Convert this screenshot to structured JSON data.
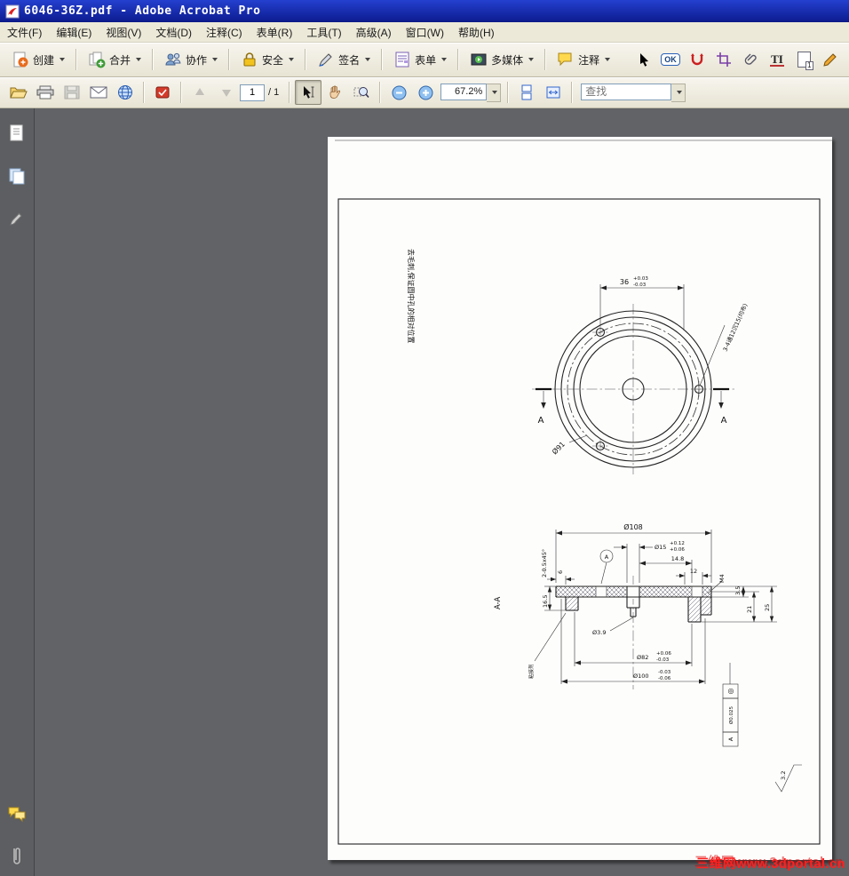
{
  "window": {
    "title": "6046-36Z.pdf - Adobe Acrobat Pro"
  },
  "colors": {
    "titlebar": "#1b2fb8",
    "toolbar": "#ece9d8",
    "canvas": "#616366",
    "watermark": "#ff2020"
  },
  "menu": {
    "items": [
      "文件(F)",
      "编辑(E)",
      "视图(V)",
      "文档(D)",
      "注释(C)",
      "表单(R)",
      "工具(T)",
      "高级(A)",
      "窗口(W)",
      "帮助(H)"
    ]
  },
  "toolbar_main": {
    "buttons": [
      "创建",
      "合并",
      "协作",
      "安全",
      "签名",
      "表单",
      "多媒体",
      "注释"
    ],
    "ok_stamp_label": "OK",
    "text_edits_label": "TI",
    "page_badge_label": "1"
  },
  "toolbar_nav": {
    "page_value": "1",
    "page_total": "/ 1",
    "zoom_value": "67.2%",
    "find_placeholder": "查找"
  },
  "drawing": {
    "note_vertical": "去毛刺,保证圆中孔的相对位置",
    "top_view": {
      "dim36": "36",
      "dim36_upper": "+0.03",
      "dim36_lower": "-0.03",
      "hole_callout": "3-4通12沉15(均布)",
      "dia91": "Ø91",
      "section_a_left": "A",
      "section_a_right": "A"
    },
    "section_view": {
      "title": "A-A",
      "dia108": "Ø108",
      "dia15": "Ø15",
      "dia15_upper": "+0.12",
      "dia15_lower": "+0.06",
      "d14_8": "14.8",
      "d12": "12",
      "m4": "M4",
      "d3_5": "3.5",
      "d21": "21",
      "d25": "25",
      "d16_5": "16.5",
      "d6": "6",
      "chamfer": "2-0.5x45°",
      "dia3_9": "Ø3.9",
      "dia82": "Ø82",
      "dia82_upper": "+0.06",
      "dia82_lower": "-0.03",
      "dia100": "Ø100",
      "dia100_upper": "-0.03",
      "dia100_lower": "-0.06",
      "datum_balloon": "A",
      "glue_note": "粘接剂",
      "fcf_symbol": "◎",
      "fcf_value": "Ø0.025",
      "fcf_datum": "A",
      "roughness": "3.2"
    }
  },
  "watermark": {
    "text": "三维网www.3dportal.cn"
  }
}
